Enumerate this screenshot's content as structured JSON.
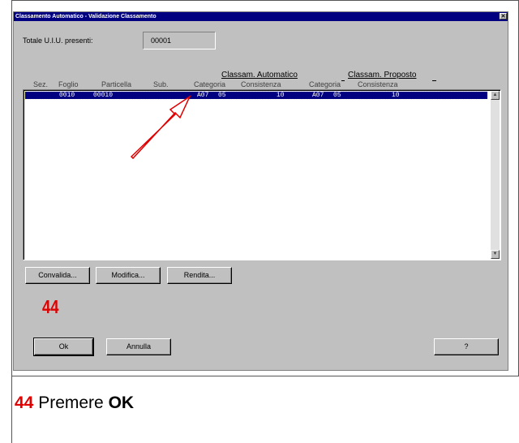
{
  "window": {
    "title": "Classamento Automatico - Validazione Classamento",
    "close_glyph": "✕"
  },
  "summary": {
    "label": "Totale U.I.U. presenti:",
    "value": "00001"
  },
  "group_headers": {
    "automatico": "Classam. Automatico",
    "proposto": "Classam. Proposto"
  },
  "columns": [
    "Sez.",
    "Foglio",
    "Particella",
    "Sub.",
    "Categoria",
    "Consistenza",
    "Categoria",
    "Consistenza"
  ],
  "rows": [
    {
      "sez": "",
      "foglio": "0010",
      "particella": "00010",
      "sub": "",
      "cat_auto": "A07",
      "cls_auto": "05",
      "cons_auto": "10",
      "cat_prop": "A07",
      "cls_prop": "05",
      "cons_prop": "10"
    }
  ],
  "buttons": {
    "convalida": "Convalida...",
    "modifica": "Modifica...",
    "rendita": "Rendita...",
    "ok": "Ok",
    "annulla": "Annulla",
    "help": "?"
  },
  "annotation": {
    "step_number": "44",
    "caption_prefix": "Premere",
    "caption_bold": "OK"
  },
  "colors": {
    "accent": "#e00000",
    "selection": "#000080",
    "window_bg": "#c0c0c0"
  },
  "icons": [
    "close-icon",
    "scroll-up-icon",
    "scroll-down-icon",
    "pointer-arrow-icon"
  ]
}
